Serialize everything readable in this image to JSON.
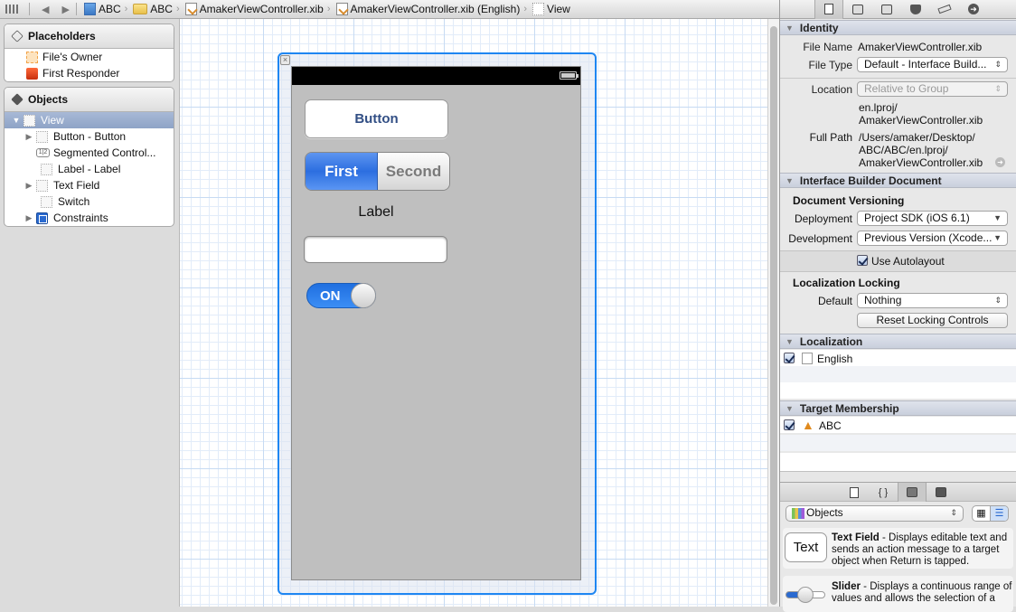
{
  "jumpbar": {
    "crumbs": [
      "ABC",
      "ABC",
      "AmakerViewController.xib",
      "AmakerViewController.xib (English)",
      "View"
    ]
  },
  "outline": {
    "placeholders_title": "Placeholders",
    "placeholders": [
      "File's Owner",
      "First Responder"
    ],
    "objects_title": "Objects",
    "tree": [
      {
        "label": "View",
        "selected": true,
        "expanded": true,
        "depth": 0
      },
      {
        "label": "Button - Button",
        "expandable": true,
        "depth": 1
      },
      {
        "label": "Segmented Control...",
        "depth": 1
      },
      {
        "label": "Label - Label",
        "depth": 1
      },
      {
        "label": "Text Field",
        "expandable": true,
        "depth": 1
      },
      {
        "label": "Switch",
        "depth": 1
      },
      {
        "label": "Constraints",
        "expandable": true,
        "depth": 1
      }
    ]
  },
  "canvas": {
    "button_title": "Button",
    "segments": [
      "First",
      "Second"
    ],
    "selected_segment": 0,
    "label_text": "Label",
    "textfield_value": "",
    "switch_text": "ON",
    "switch_on": true
  },
  "inspector": {
    "identity": {
      "title": "Identity",
      "file_name_label": "File Name",
      "file_name": "AmakerViewController.xib",
      "file_type_label": "File Type",
      "file_type": "Default - Interface Build...",
      "location_label": "Location",
      "location": "Relative to Group",
      "location_path_1": "en.lproj/",
      "location_path_2": "AmakerViewController.xib",
      "full_path_label": "Full Path",
      "full_path_1": "/Users/amaker/Desktop/",
      "full_path_2": "ABC/ABC/en.lproj/",
      "full_path_3": "AmakerViewController.xib"
    },
    "ib_document": {
      "title": "Interface Builder Document",
      "versioning_title": "Document Versioning",
      "deployment_label": "Deployment",
      "deployment": "Project SDK (iOS 6.1)",
      "development_label": "Development",
      "development": "Previous Version (Xcode...",
      "autolayout_label": "Use Autolayout",
      "autolayout_checked": true,
      "locking_title": "Localization Locking",
      "default_label": "Default",
      "default_value": "Nothing",
      "reset_button": "Reset Locking Controls"
    },
    "localization": {
      "title": "Localization",
      "items": [
        {
          "label": "English",
          "checked": true
        }
      ]
    },
    "target_membership": {
      "title": "Target Membership",
      "items": [
        {
          "label": "ABC",
          "checked": true
        }
      ]
    },
    "library": {
      "selector": "Objects",
      "items": [
        {
          "preview": "Text",
          "name": "Text Field",
          "desc_1": " - Displays editable text and",
          "desc_2": "sends an action message to a target",
          "desc_3": "object when Return is tapped."
        },
        {
          "name": "Slider",
          "desc_1": " - Displays a continuous range of",
          "desc_2": "values and allows the selection of a"
        }
      ]
    }
  }
}
